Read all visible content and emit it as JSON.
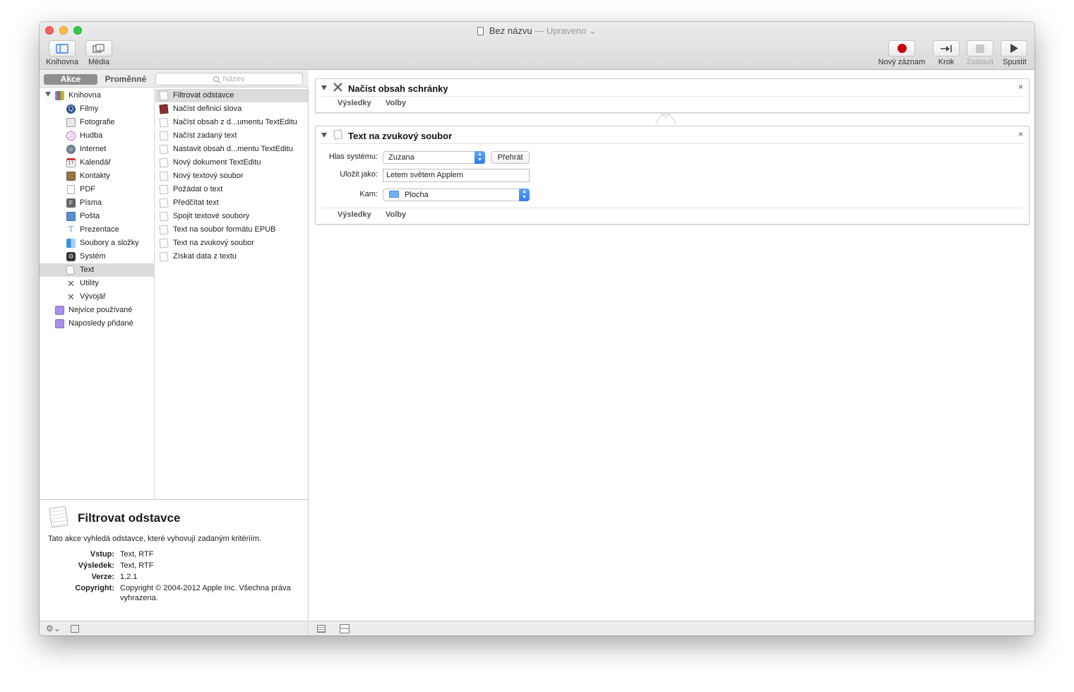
{
  "window": {
    "title": "Bez názvu",
    "title_separator": "—",
    "status": "Upraveno",
    "status_chevron": "⌄"
  },
  "toolbar": {
    "library_label": "Knihovna",
    "media_label": "Média",
    "record_label": "Nový záznam",
    "step_label": "Krok",
    "stop_label": "Zastavit",
    "run_label": "Spustit"
  },
  "library_panel": {
    "tab_actions": "Akce",
    "tab_variables": "Proměnné",
    "search_placeholder": "Název",
    "categories": [
      {
        "label": "Knihovna",
        "icon": "library-icon",
        "level": 0
      },
      {
        "label": "Filmy",
        "icon": "quicktime-icon",
        "level": 1
      },
      {
        "label": "Fotografie",
        "icon": "photos-icon",
        "level": 1
      },
      {
        "label": "Hudba",
        "icon": "music-note-icon",
        "level": 1
      },
      {
        "label": "Internet",
        "icon": "globe-icon",
        "level": 1
      },
      {
        "label": "Kalendář",
        "icon": "calendar-icon",
        "level": 1
      },
      {
        "label": "Kontakty",
        "icon": "contacts-icon",
        "level": 1
      },
      {
        "label": "PDF",
        "icon": "pdf-icon",
        "level": 1
      },
      {
        "label": "Písma",
        "icon": "fonts-icon",
        "level": 1
      },
      {
        "label": "Pošta",
        "icon": "mail-icon",
        "level": 1
      },
      {
        "label": "Prezentace",
        "icon": "presentation-icon",
        "level": 1
      },
      {
        "label": "Soubory a složky",
        "icon": "finder-icon",
        "level": 1
      },
      {
        "label": "Systém",
        "icon": "system-icon",
        "level": 1
      },
      {
        "label": "Text",
        "icon": "text-icon",
        "level": 1,
        "selected": true
      },
      {
        "label": "Utility",
        "icon": "utilities-icon",
        "level": 1
      },
      {
        "label": "Vývojář",
        "icon": "developer-icon",
        "level": 1
      },
      {
        "label": "Nejvíce používané",
        "icon": "smart-folder-icon",
        "level": 0
      },
      {
        "label": "Naposledy přidané",
        "icon": "smart-folder-icon",
        "level": 0
      }
    ],
    "actions": [
      {
        "label": "Filtrovat odstavce",
        "selected": true
      },
      {
        "label": "Načíst definici slova",
        "icon": "dictionary-icon"
      },
      {
        "label": "Načíst obsah z d...umentu TextEditu"
      },
      {
        "label": "Načíst zadaný text"
      },
      {
        "label": "Nastavit obsah d...mentu TextEditu"
      },
      {
        "label": "Nový dokument TextEditu"
      },
      {
        "label": "Nový textový soubor"
      },
      {
        "label": "Požádat o text"
      },
      {
        "label": "Předčítat text"
      },
      {
        "label": "Spojit textové soubory"
      },
      {
        "label": "Text na soubor formátu EPUB"
      },
      {
        "label": "Text na zvukový soubor"
      },
      {
        "label": "Získat data z textu"
      }
    ]
  },
  "description": {
    "title": "Filtrovat odstavce",
    "text": "Tato akce vyhledá odstavce, které vyhovují zadaným kritériím.",
    "rows": [
      {
        "key": "Vstup:",
        "value": "Text, RTF"
      },
      {
        "key": "Výsledek:",
        "value": "Text, RTF"
      },
      {
        "key": "Verze:",
        "value": "1.2.1"
      },
      {
        "key": "Copyright:",
        "value": "Copyright © 2004-2012 Apple Inc. Všechna práva vyhrazena."
      }
    ]
  },
  "workflow": {
    "step1": {
      "title": "Načíst obsah schránky",
      "results_tab": "Výsledky",
      "options_tab": "Volby"
    },
    "step2": {
      "title": "Text na zvukový soubor",
      "voice_label": "Hlas systému:",
      "voice_value": "Zuzana",
      "play_button": "Přehrát",
      "save_as_label": "Uložit jako:",
      "save_as_value": "Letem světem Applem",
      "where_label": "Kam:",
      "where_value": "Plocha",
      "results_tab": "Výsledky",
      "options_tab": "Volby"
    },
    "close_glyph": "×"
  },
  "colors": {
    "record_red": "#c50010",
    "popup_blue": "#2d7ef0",
    "selection_gray": "#dcdcdc"
  }
}
